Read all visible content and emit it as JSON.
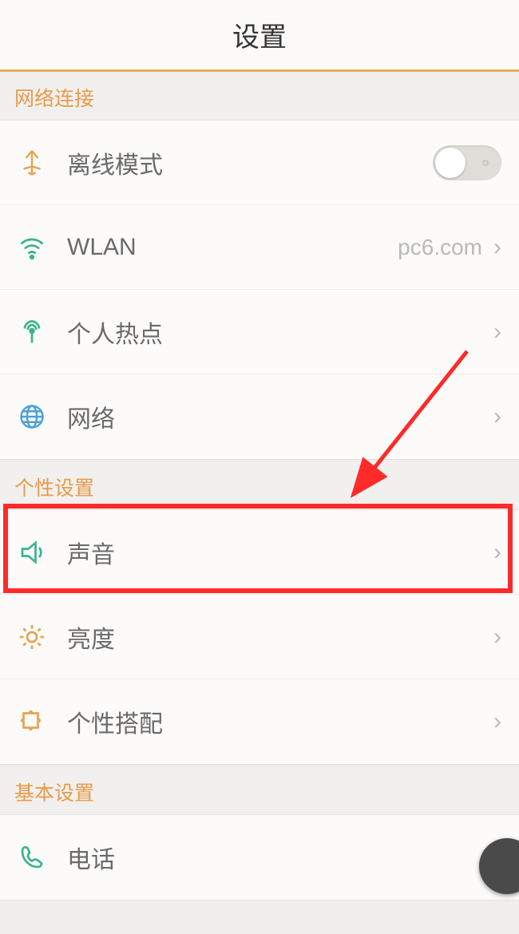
{
  "header": {
    "title": "设置"
  },
  "sections": {
    "network": {
      "title": "网络连接",
      "airplane": "离线模式",
      "wlan": "WLAN",
      "wlan_value": "pc6.com",
      "hotspot": "个人热点",
      "net": "网络"
    },
    "personal": {
      "title": "个性设置",
      "sound": "声音",
      "brightness": "亮度",
      "theme": "个性搭配"
    },
    "basic": {
      "title": "基本设置",
      "phone": "电话"
    }
  },
  "colors": {
    "accent": "#e89a4a",
    "icon_green": "#3bb38c",
    "icon_orange": "#e8a350",
    "icon_blue": "#4aa0d8"
  }
}
